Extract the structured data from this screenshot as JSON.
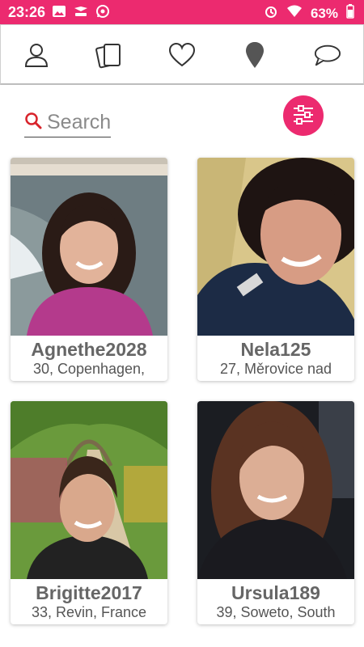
{
  "status": {
    "time": "23:26",
    "battery": "63%",
    "bar_color": "#ec2a6f",
    "left_icons": [
      "image-icon",
      "pay-icon",
      "whatsapp-icon"
    ],
    "right_icons": [
      "alarm-icon",
      "wifi-icon",
      "battery-icon"
    ]
  },
  "nav": {
    "items": [
      "profile-icon",
      "cards-icon",
      "heart-icon",
      "location-pin-icon",
      "chat-bubble-icon"
    ]
  },
  "search": {
    "placeholder": "Search",
    "icon": "search-icon"
  },
  "filter": {
    "icon": "sliders-icon",
    "color": "#ec2a6f"
  },
  "profiles": [
    {
      "name": "Agnethe2028",
      "meta": "30, Copenhagen,"
    },
    {
      "name": "Nela125",
      "meta": "27, Měrovice nad"
    },
    {
      "name": "Brigitte2017",
      "meta": "33, Revin, France"
    },
    {
      "name": "Ursula189",
      "meta": "39, Soweto, South"
    }
  ]
}
